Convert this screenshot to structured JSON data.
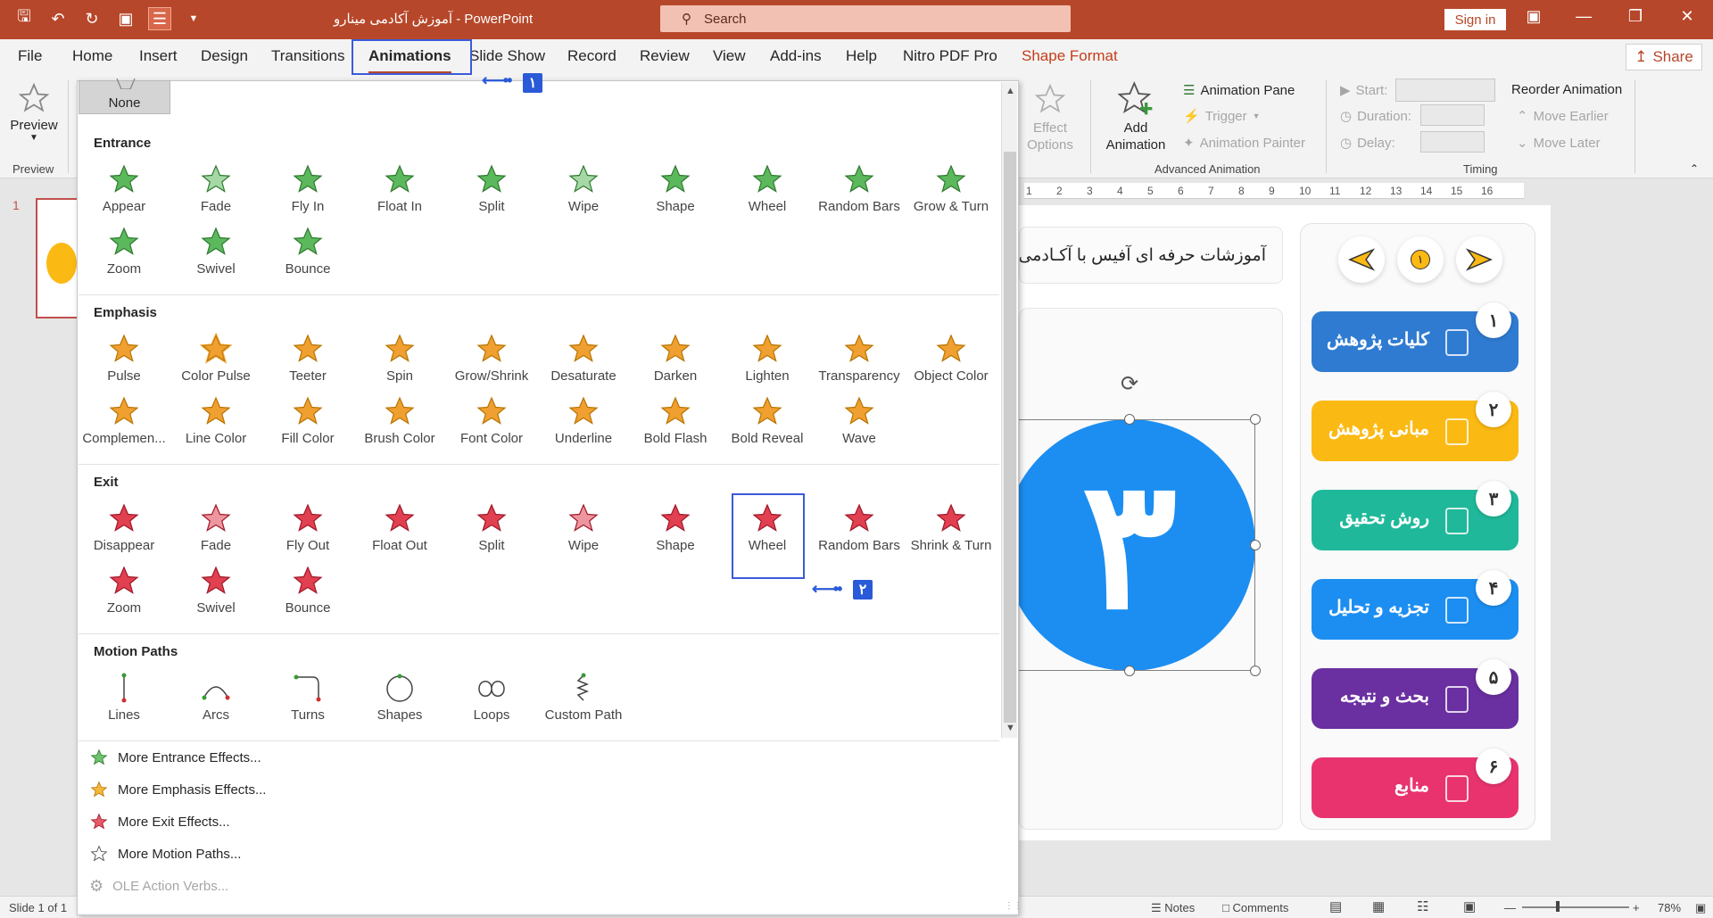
{
  "titlebar": {
    "doc_title": "آموزش آکادمی مینارو  -  PowerPoint",
    "search_placeholder": "Search",
    "sign_in": "Sign in"
  },
  "tabs": [
    "File",
    "Home",
    "Insert",
    "Design",
    "Transitions",
    "Animations",
    "Slide Show",
    "Record",
    "Review",
    "View",
    "Add-ins",
    "Help",
    "Nitro PDF Pro",
    "Shape Format"
  ],
  "share": "Share",
  "ribbon": {
    "preview": {
      "label": "Preview",
      "group": "Preview"
    },
    "effect_options": "Effect Options",
    "add_animation": "Add Animation",
    "animation_pane": "Animation Pane",
    "trigger": "Trigger",
    "animation_painter": "Animation Painter",
    "advanced_group": "Advanced Animation",
    "start": "Start:",
    "duration": "Duration:",
    "delay": "Delay:",
    "timing_group": "Timing",
    "reorder": "Reorder Animation",
    "move_earlier": "Move Earlier",
    "move_later": "Move Later"
  },
  "gallery": {
    "none": "None",
    "sections": {
      "entrance": {
        "title": "Entrance",
        "items": [
          "Appear",
          "Fade",
          "Fly In",
          "Float In",
          "Split",
          "Wipe",
          "Shape",
          "Wheel",
          "Random Bars",
          "Grow & Turn",
          "Zoom",
          "Swivel",
          "Bounce"
        ]
      },
      "emphasis": {
        "title": "Emphasis",
        "items": [
          "Pulse",
          "Color Pulse",
          "Teeter",
          "Spin",
          "Grow/Shrink",
          "Desaturate",
          "Darken",
          "Lighten",
          "Transparency",
          "Object Color",
          "Complemen...",
          "Line Color",
          "Fill Color",
          "Brush Color",
          "Font Color",
          "Underline",
          "Bold Flash",
          "Bold Reveal",
          "Wave"
        ]
      },
      "exit": {
        "title": "Exit",
        "items": [
          "Disappear",
          "Fade",
          "Fly Out",
          "Float Out",
          "Split",
          "Wipe",
          "Shape",
          "Wheel",
          "Random Bars",
          "Shrink & Turn",
          "Zoom",
          "Swivel",
          "Bounce"
        ]
      },
      "motion": {
        "title": "Motion Paths",
        "items": [
          "Lines",
          "Arcs",
          "Turns",
          "Shapes",
          "Loops",
          "Custom Path"
        ]
      }
    },
    "more": [
      "More Entrance Effects...",
      "More Emphasis Effects...",
      "More Exit Effects...",
      "More Motion Paths...",
      "OLE Action Verbs..."
    ]
  },
  "annotations": {
    "badge1": "۱",
    "badge2": "۲"
  },
  "slide": {
    "thumb_number": "1",
    "header_text": "آموزشات حرفه ای آفیس با آکـادمی",
    "big_number": "۳",
    "nav_page": "۱",
    "menu": [
      {
        "num": "۱",
        "label": "کلیات پژوهش",
        "color": "#2f7bd1"
      },
      {
        "num": "۲",
        "label": "مبانی پژوهش",
        "color": "#fbb913"
      },
      {
        "num": "۳",
        "label": "روش تحقیق",
        "color": "#20b89a"
      },
      {
        "num": "۴",
        "label": "تجزیه و تحلیل",
        "color": "#1c8ef1"
      },
      {
        "num": "۵",
        "label": "بحث و نتیجه",
        "color": "#6a2fa0"
      },
      {
        "num": "۶",
        "label": "منابع",
        "color": "#e8336f"
      }
    ],
    "ruler": [
      "1",
      "2",
      "3",
      "4",
      "5",
      "6",
      "7",
      "8",
      "9",
      "10",
      "11",
      "12",
      "13",
      "14",
      "15",
      "16"
    ]
  },
  "status": {
    "slide": "Slide 1 of 1",
    "notes": "Notes",
    "comments": "Comments",
    "zoom": "78%"
  },
  "colors": {
    "accent": "#b7472a",
    "entrance": "#5cb85c",
    "emphasis": "#f0a030",
    "exit": "#e04050",
    "annotation": "#2a5ad8"
  }
}
